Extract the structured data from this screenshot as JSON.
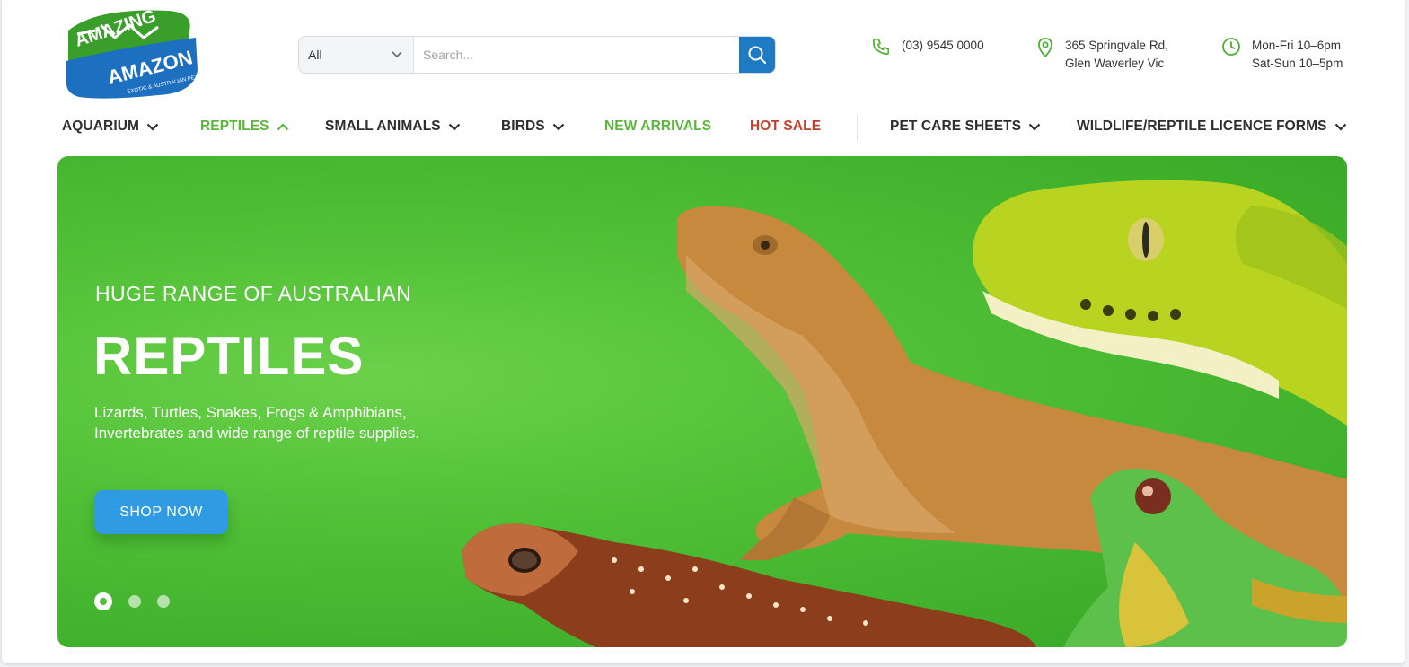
{
  "logo": {
    "line1": "AMAZING",
    "line2": "AMAZON",
    "tagline": "EXOTIC & AUSTRALIAN PETS"
  },
  "search": {
    "category": "All",
    "placeholder": "Search..."
  },
  "contact": {
    "phone": "(03) 9545 0000",
    "address_line1": "365 Springvale Rd,",
    "address_line2": "Glen Waverley Vic",
    "hours_line1": "Mon-Fri 10–6pm",
    "hours_line2": "Sat-Sun 10–5pm"
  },
  "nav": {
    "aquarium": "AQUARIUM",
    "reptiles": "REPTILES",
    "small_animals": "SMALL ANIMALS",
    "birds": "BIRDS",
    "new_arrivals": "NEW ARRIVALS",
    "hot_sale": "HOT SALE",
    "pet_care": "PET CARE SHEETS",
    "licence_forms": "WILDLIFE/REPTILE LICENCE FORMS"
  },
  "colors": {
    "active_green": "#5bb73b",
    "hot_red": "#c0412b",
    "accent_blue": "#1d7ac3",
    "hero_green": "#4fbf36"
  },
  "hero": {
    "eyebrow": "HUGE RANGE OF AUSTRALIAN",
    "headline": "REPTILES",
    "description": "Lizards, Turtles, Snakes, Frogs & Amphibians, Invertebrates and wide range of  reptile supplies.",
    "cta": "SHOP NOW",
    "slide_count": 3,
    "active_slide": 1
  }
}
